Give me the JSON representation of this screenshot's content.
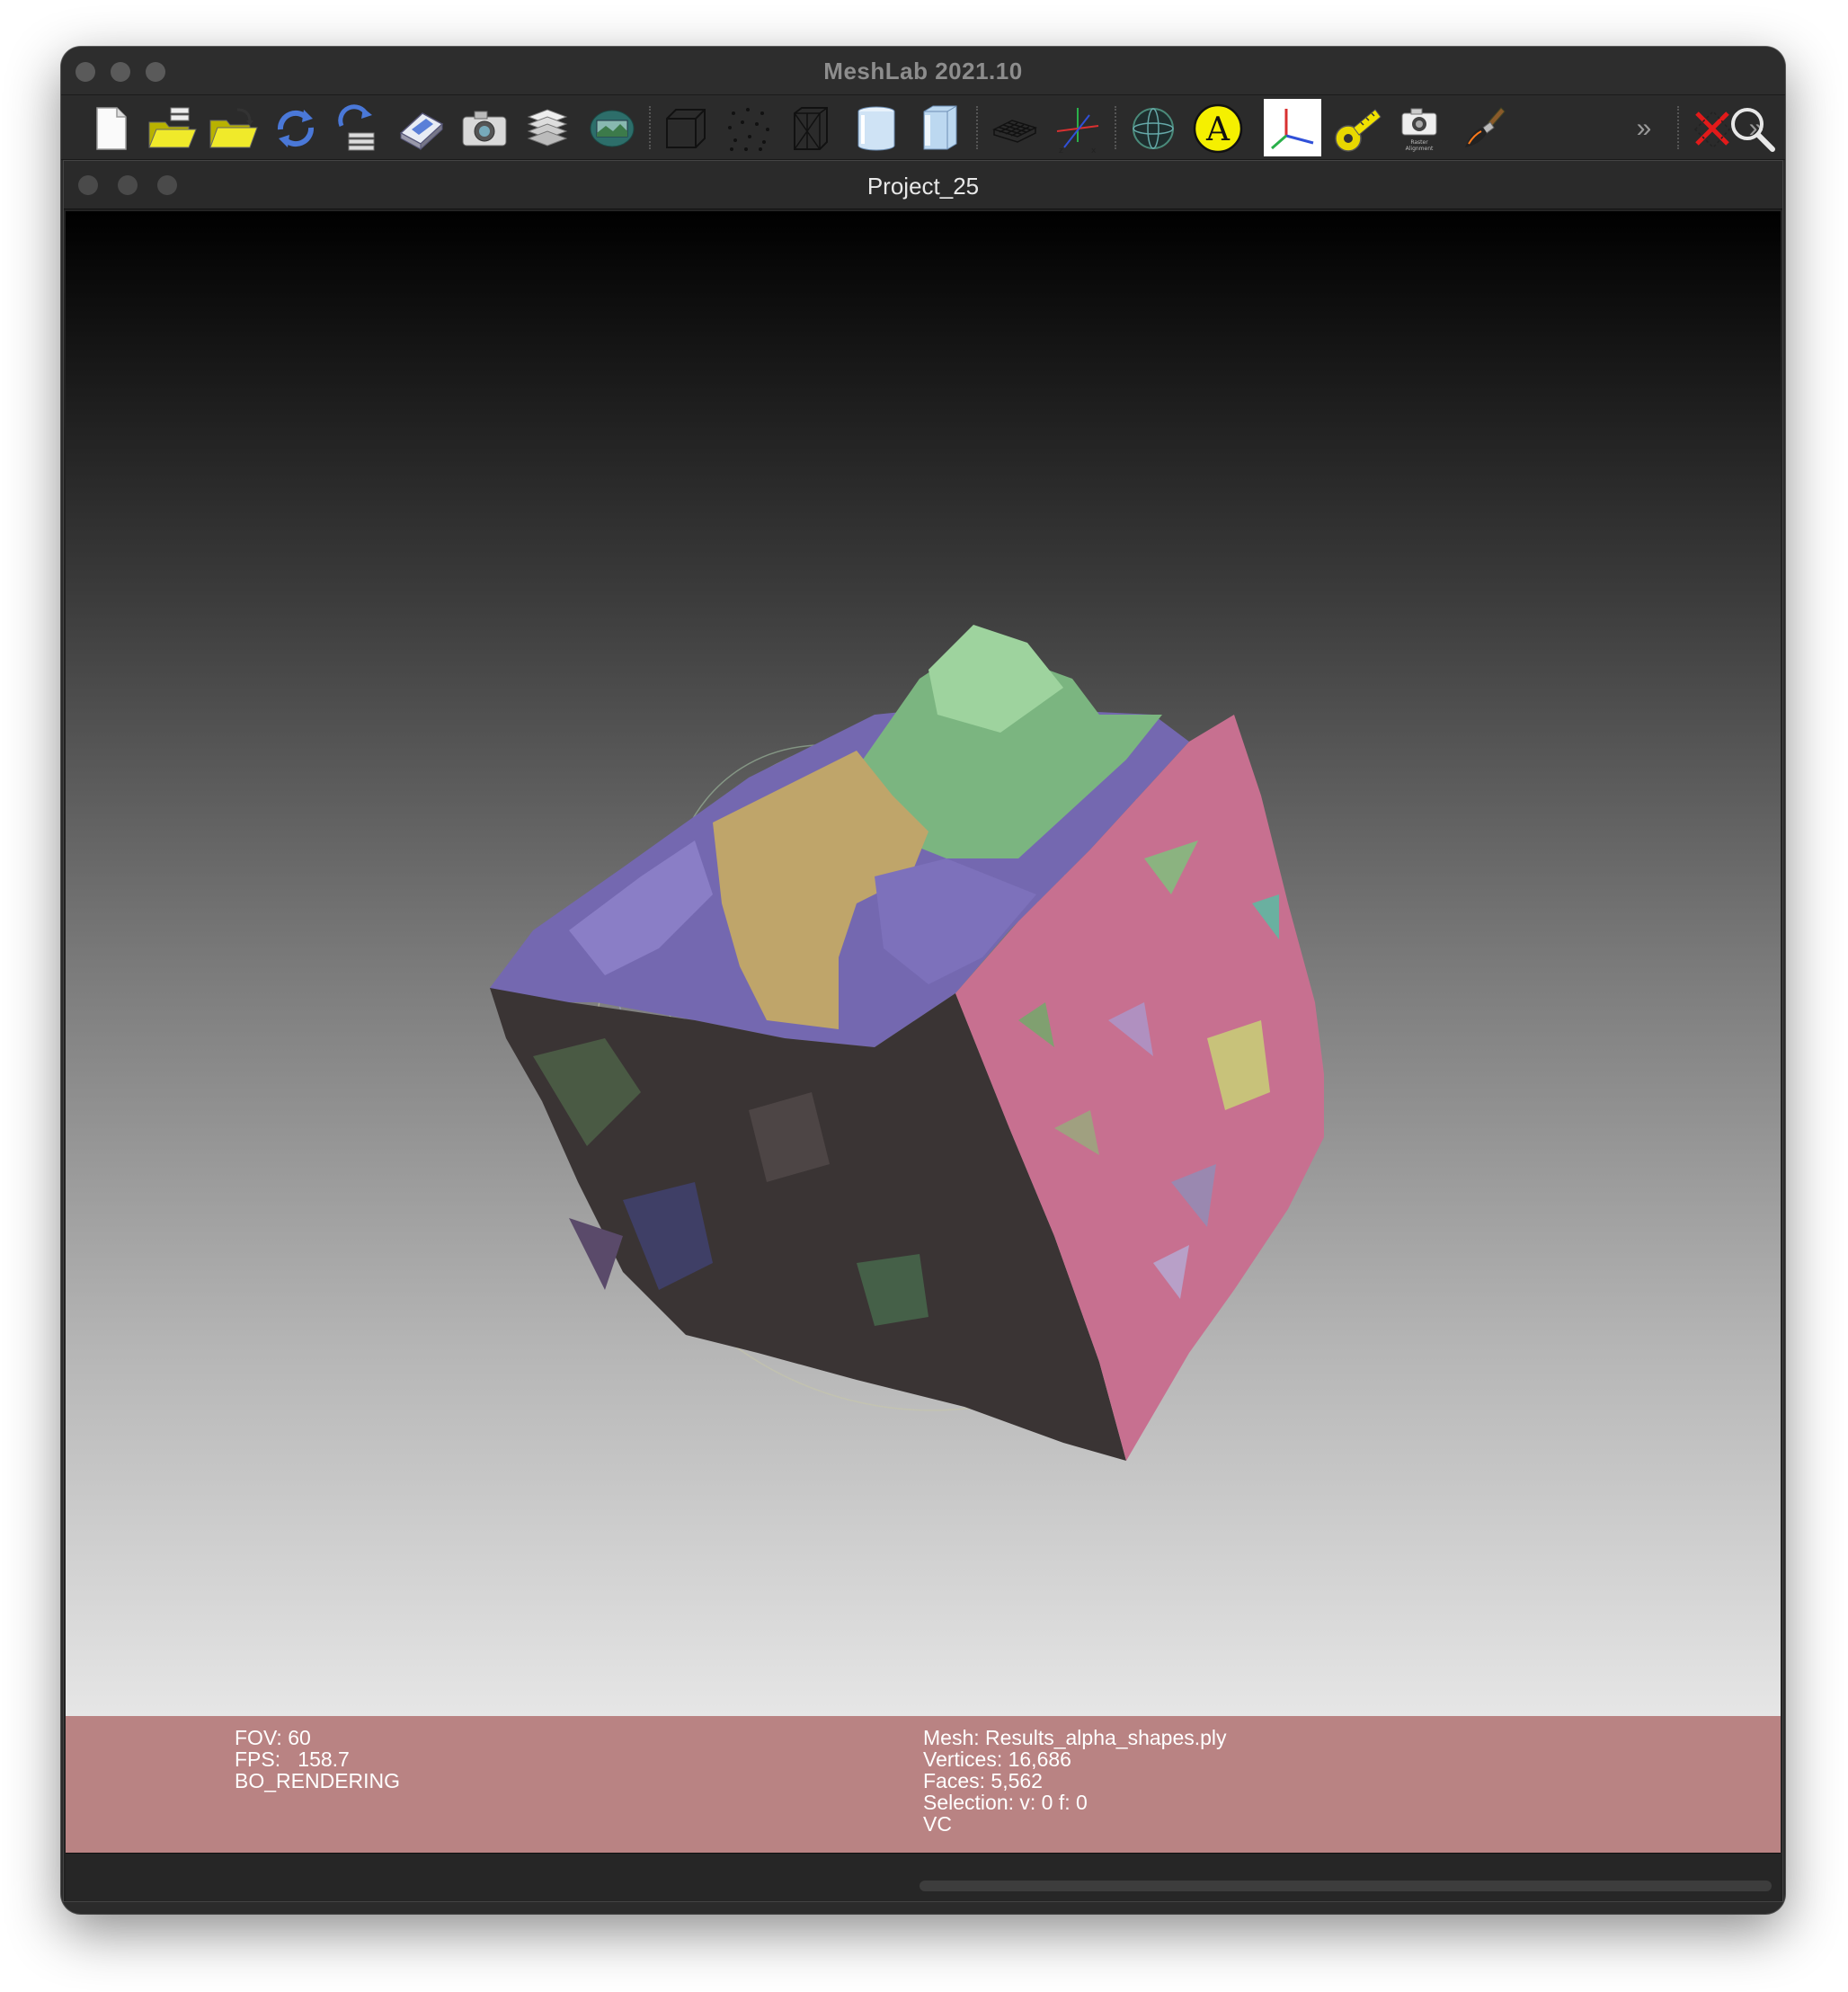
{
  "app": {
    "title": "MeshLab 2021.10"
  },
  "toolbar": {
    "buttons": [
      {
        "name": "new-project-icon"
      },
      {
        "name": "open-project-icon"
      },
      {
        "name": "import-mesh-icon"
      },
      {
        "name": "reload-icon"
      },
      {
        "name": "reload-all-icon"
      },
      {
        "name": "export-mesh-icon"
      },
      {
        "name": "snapshot-icon"
      },
      {
        "name": "layers-icon"
      },
      {
        "name": "raster-icon"
      },
      {
        "name": "bbox-render-icon"
      },
      {
        "name": "points-render-icon"
      },
      {
        "name": "wireframe-render-icon"
      },
      {
        "name": "flat-render-icon"
      },
      {
        "name": "smooth-render-icon"
      },
      {
        "name": "grid-icon"
      },
      {
        "name": "axes-icon"
      },
      {
        "name": "trackball-icon"
      },
      {
        "name": "annotate-icon"
      },
      {
        "name": "align-axes-icon"
      },
      {
        "name": "measure-tool-icon"
      },
      {
        "name": "raster-alignment-icon",
        "label": "Raster Alignment"
      },
      {
        "name": "paint-brush-icon"
      },
      {
        "name": "overflow-chevron-icon",
        "label": "»"
      },
      {
        "name": "no-selection-icon"
      },
      {
        "name": "overflow-chevron-icon-2",
        "label": "»"
      },
      {
        "name": "search-icon"
      }
    ]
  },
  "project": {
    "title": "Project_25"
  },
  "info": {
    "fov": "FOV: 60",
    "fps": "FPS:   158.7",
    "mode": "BO_RENDERING",
    "mesh": "Mesh: Results_alpha_shapes.ply",
    "vertices": "Vertices: 16,686",
    "faces": "Faces: 5,562",
    "selection": "Selection: v: 0 f: 0",
    "color": "VC"
  },
  "colors": {
    "info_panel": "#b98383",
    "face_top_green": "#7bb580",
    "face_top_purple": "#7468b0",
    "face_top_tan": "#bfa56a",
    "face_right_pink": "#c77090",
    "face_left_dark": "#3a3434"
  }
}
